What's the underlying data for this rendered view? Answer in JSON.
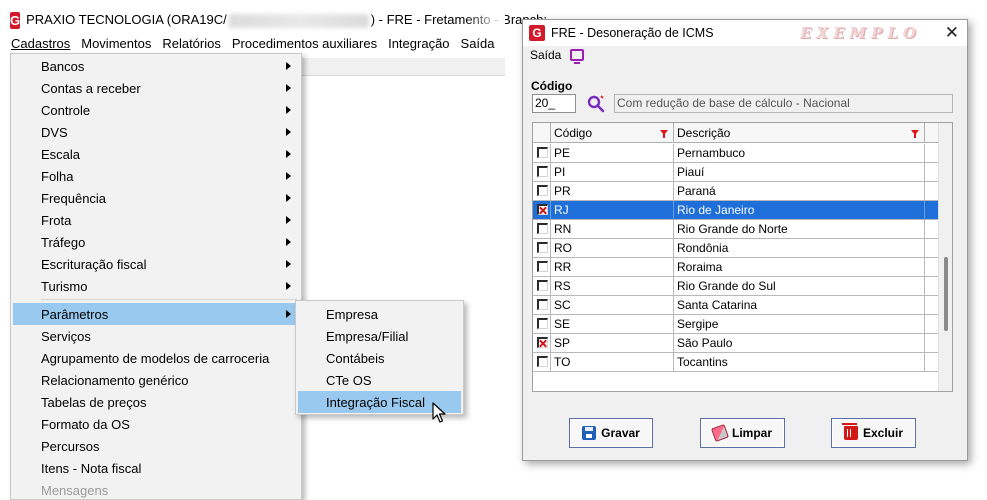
{
  "main_window": {
    "title_prefix": "PRAXIO TECNOLOGIA (ORA19C/",
    "title_suffix": ") - FRE - Fretamento - Branch:",
    "logo_letter": "G"
  },
  "menubar": [
    {
      "label": "Cadastros"
    },
    {
      "label": "Movimentos"
    },
    {
      "label": "Relatórios"
    },
    {
      "label": "Procedimentos auxiliares"
    },
    {
      "label": "Integração"
    },
    {
      "label": "Saída"
    }
  ],
  "dropdown": {
    "items": [
      {
        "label": "Bancos",
        "submenu": true
      },
      {
        "label": "Contas a receber",
        "submenu": true
      },
      {
        "label": "Controle",
        "submenu": true
      },
      {
        "label": "DVS",
        "submenu": true
      },
      {
        "label": "Escala",
        "submenu": true
      },
      {
        "label": "Folha",
        "submenu": true
      },
      {
        "label": "Frequência",
        "submenu": true
      },
      {
        "label": "Frota",
        "submenu": true
      },
      {
        "label": "Tráfego",
        "submenu": true
      },
      {
        "label": "Escrituração fiscal",
        "submenu": true
      },
      {
        "label": "Turismo",
        "submenu": true
      },
      {
        "label": "Parâmetros",
        "submenu": true,
        "active": true
      },
      {
        "label": "Serviços"
      },
      {
        "label": "Agrupamento de modelos de carroceria"
      },
      {
        "label": "Relacionamento genérico"
      },
      {
        "label": "Tabelas de preços"
      },
      {
        "label": "Formato da OS"
      },
      {
        "label": "Percursos"
      },
      {
        "label": "Itens - Nota fiscal"
      },
      {
        "label": "Mensagens",
        "dim": true
      }
    ]
  },
  "submenu": {
    "items": [
      {
        "label": "Empresa"
      },
      {
        "label": "Empresa/Filial"
      },
      {
        "label": "Contábeis"
      },
      {
        "label": "CTe OS"
      },
      {
        "label": "Integração Fiscal",
        "highlighted": true
      }
    ]
  },
  "dialog": {
    "title": "FRE - Desoneração de ICMS",
    "watermark": "EXEMPLO",
    "close_label": "✕",
    "saida_label": "Saída",
    "codigo_label": "Código",
    "codigo_value": "20_",
    "descricao_value": "Com redução de base de cálculo - Nacional",
    "grid": {
      "headers": {
        "codigo": "Código",
        "descricao": "Descrição"
      },
      "rows": [
        {
          "code": "PE",
          "name": "Pernambuco",
          "checked": false,
          "selected": false
        },
        {
          "code": "PI",
          "name": "Piauí",
          "checked": false,
          "selected": false
        },
        {
          "code": "PR",
          "name": "Paraná",
          "checked": false,
          "selected": false
        },
        {
          "code": "RJ",
          "name": "Rio de Janeiro",
          "checked": true,
          "selected": true
        },
        {
          "code": "RN",
          "name": "Rio Grande do Norte",
          "checked": false,
          "selected": false
        },
        {
          "code": "RO",
          "name": "Rondônia",
          "checked": false,
          "selected": false
        },
        {
          "code": "RR",
          "name": "Roraima",
          "checked": false,
          "selected": false
        },
        {
          "code": "RS",
          "name": "Rio Grande do Sul",
          "checked": false,
          "selected": false
        },
        {
          "code": "SC",
          "name": "Santa Catarina",
          "checked": false,
          "selected": false
        },
        {
          "code": "SE",
          "name": "Sergipe",
          "checked": false,
          "selected": false
        },
        {
          "code": "SP",
          "name": "São Paulo",
          "checked": true,
          "selected": false
        },
        {
          "code": "TO",
          "name": "Tocantins",
          "checked": false,
          "selected": false
        }
      ]
    },
    "buttons": {
      "gravar": "Gravar",
      "limpar": "Limpar",
      "excluir": "Excluir"
    }
  },
  "colors": {
    "brand_red": "#d3192a",
    "menu_highlight": "#99c9ef",
    "row_selected": "#1e6fd9",
    "check_mark": "#d0141a"
  }
}
